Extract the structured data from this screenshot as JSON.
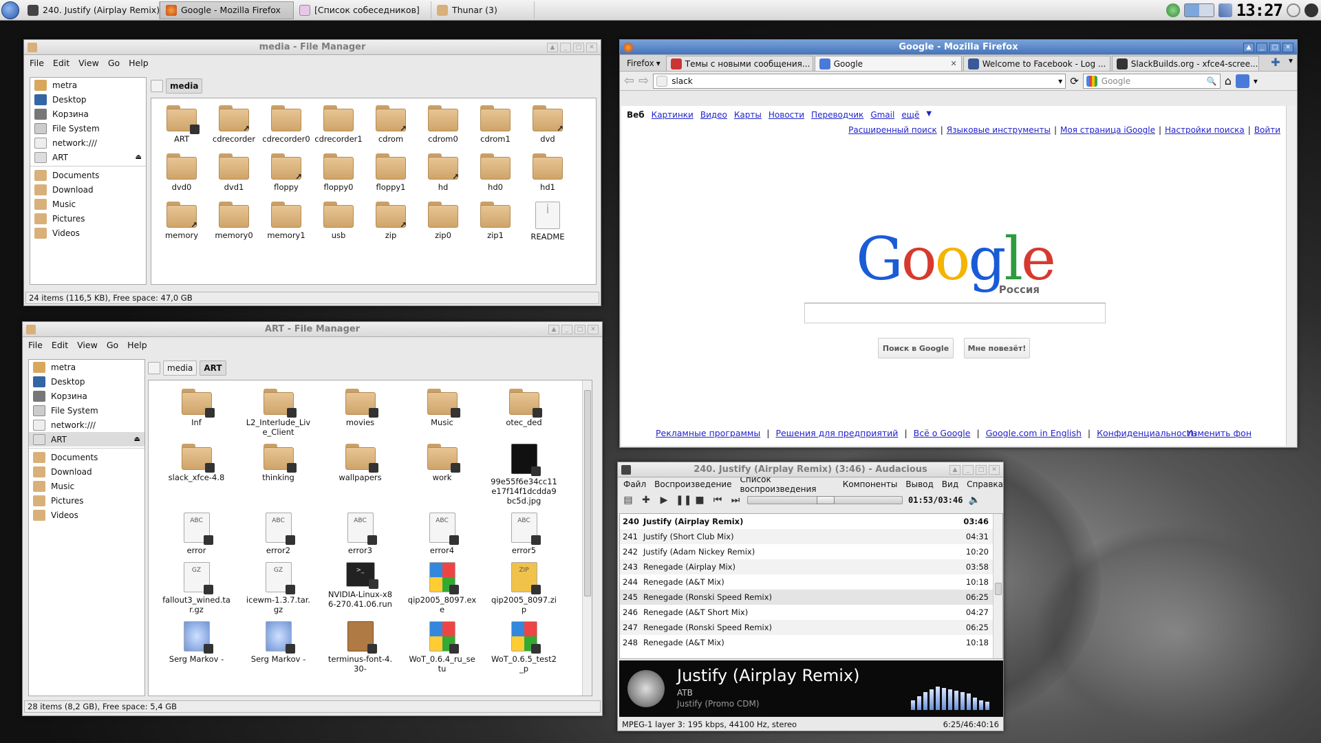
{
  "taskbar": {
    "tasks": [
      {
        "label": "240. Justify (Airplay Remix) (...",
        "icon": "audacious-icon"
      },
      {
        "label": "Google - Mozilla Firefox",
        "icon": "firefox-icon"
      },
      {
        "label": "[Список собеседников]",
        "icon": "chat-icon"
      },
      {
        "label": "Thunar (3)",
        "icon": "folder-icon"
      }
    ],
    "clock": "13:27"
  },
  "fm1": {
    "title": "media - File Manager",
    "menu": [
      "File",
      "Edit",
      "View",
      "Go",
      "Help"
    ],
    "sidebar": [
      "metra",
      "Desktop",
      "Корзина",
      "File System",
      "network:///",
      "ART",
      "Documents",
      "Download",
      "Music",
      "Pictures",
      "Videos"
    ],
    "crumbs": [
      "media"
    ],
    "items": [
      {
        "name": "ART",
        "badge": "lock"
      },
      {
        "name": "cdrecorder",
        "badge": "link"
      },
      {
        "name": "cdrecorder0",
        "badge": ""
      },
      {
        "name": "cdrecorder1",
        "badge": ""
      },
      {
        "name": "cdrom",
        "badge": "link"
      },
      {
        "name": "cdrom0",
        "badge": ""
      },
      {
        "name": "cdrom1",
        "badge": ""
      },
      {
        "name": "dvd",
        "badge": "link"
      },
      {
        "name": "dvd0",
        "badge": ""
      },
      {
        "name": "dvd1",
        "badge": ""
      },
      {
        "name": "floppy",
        "badge": "link"
      },
      {
        "name": "floppy0",
        "badge": ""
      },
      {
        "name": "floppy1",
        "badge": ""
      },
      {
        "name": "hd",
        "badge": "link"
      },
      {
        "name": "hd0",
        "badge": ""
      },
      {
        "name": "hd1",
        "badge": ""
      },
      {
        "name": "memory",
        "badge": "link"
      },
      {
        "name": "memory0",
        "badge": ""
      },
      {
        "name": "memory1",
        "badge": ""
      },
      {
        "name": "usb",
        "badge": ""
      },
      {
        "name": "zip",
        "badge": "link"
      },
      {
        "name": "zip0",
        "badge": ""
      },
      {
        "name": "zip1",
        "badge": ""
      },
      {
        "name": "README",
        "badge": "",
        "type": "info"
      }
    ],
    "status": "24 items (116,5 KB), Free space: 47,0 GB"
  },
  "fm2": {
    "title": "ART - File Manager",
    "menu": [
      "File",
      "Edit",
      "View",
      "Go",
      "Help"
    ],
    "sidebar": [
      "metra",
      "Desktop",
      "Корзина",
      "File System",
      "network:///",
      "ART",
      "Documents",
      "Download",
      "Music",
      "Pictures",
      "Videos"
    ],
    "crumbs": [
      "media",
      "ART"
    ],
    "items": [
      {
        "name": "Inf",
        "type": "folder"
      },
      {
        "name": "L2_Interlude_Live_Client",
        "type": "folder"
      },
      {
        "name": "movies",
        "type": "folder"
      },
      {
        "name": "Music",
        "type": "folder"
      },
      {
        "name": "otec_ded",
        "type": "folder"
      },
      {
        "name": "slack_xfce-4.8",
        "type": "folder"
      },
      {
        "name": "thinking",
        "type": "folder"
      },
      {
        "name": "wallpapers",
        "type": "folder"
      },
      {
        "name": "work",
        "type": "folder"
      },
      {
        "name": "99e55f6e34cc11e17f14f1dcdda9bc5d.jpg",
        "type": "image"
      },
      {
        "name": "error",
        "type": "text"
      },
      {
        "name": "error2",
        "type": "text"
      },
      {
        "name": "error3",
        "type": "text"
      },
      {
        "name": "error4",
        "type": "text"
      },
      {
        "name": "error5",
        "type": "text"
      },
      {
        "name": "fallout3_wined.tar.gz",
        "type": "gz"
      },
      {
        "name": "icewm-1.3.7.tar.gz",
        "type": "gz"
      },
      {
        "name": "NVIDIA-Linux-x86-270.41.06.run",
        "type": "run"
      },
      {
        "name": "qip2005_8097.exe",
        "type": "exe"
      },
      {
        "name": "qip2005_8097.zip",
        "type": "zip"
      },
      {
        "name": "Serg Markov -",
        "type": "html"
      },
      {
        "name": "Serg Markov -",
        "type": "html"
      },
      {
        "name": "terminus-font-4.30-",
        "type": "pkg"
      },
      {
        "name": "WoT_0.6.4_ru_setu",
        "type": "exe"
      },
      {
        "name": "WoT_0.6.5_test2_p",
        "type": "exe"
      }
    ],
    "status": "28 items (8,2 GB), Free space: 5,4 GB"
  },
  "firefox": {
    "title": "Google - Mozilla Firefox",
    "menu_label": "Firefox",
    "tabs": [
      {
        "label": "Темы с новыми сообщения...",
        "sel": false
      },
      {
        "label": "Google",
        "sel": true
      },
      {
        "label": "Welcome to Facebook - Log ...",
        "sel": false
      },
      {
        "label": "SlackBuilds.org - xfce4-scree...",
        "sel": false
      }
    ],
    "url": "slack",
    "search_placeholder": "Google",
    "topnav": [
      "Веб",
      "Картинки",
      "Видео",
      "Карты",
      "Новости",
      "Переводчик",
      "Gmail",
      "ещё"
    ],
    "toplinks": [
      "Расширенный поиск",
      "Языковые инструменты",
      "Моя страница iGoogle",
      "Настройки поиска",
      "Войти"
    ],
    "logo": "Google",
    "logo_sub": "Россия",
    "btn_search": "Поиск в Google",
    "btn_lucky": "Мне повезёт!",
    "footer": [
      "Рекламные программы",
      "Решения для предприятий",
      "Всё о Google",
      "Google.com in English",
      "Конфиденциальность"
    ],
    "change_bg": "Изменить фон"
  },
  "audacious": {
    "title": "240. Justify (Airplay Remix) (3:46) - Audacious",
    "menu": [
      "Файл",
      "Воспроизведение",
      "Список воспроизведения",
      "Компоненты",
      "Вывод",
      "Вид",
      "Справка"
    ],
    "time": "01:53/03:46",
    "progress": 0.5,
    "playlist": [
      {
        "n": "240",
        "title": "Justify (Airplay Remix)",
        "len": "03:46",
        "current": true
      },
      {
        "n": "241",
        "title": "Justify (Short Club Mix)",
        "len": "04:31"
      },
      {
        "n": "242",
        "title": "Justify (Adam Nickey Remix)",
        "len": "10:20"
      },
      {
        "n": "243",
        "title": "Renegade (Airplay Mix)",
        "len": "03:58"
      },
      {
        "n": "244",
        "title": "Renegade (A&T Mix)",
        "len": "10:18"
      },
      {
        "n": "245",
        "title": "Renegade (Ronski Speed Remix)",
        "len": "06:25",
        "selected": true
      },
      {
        "n": "246",
        "title": "Renegade (A&T Short Mix)",
        "len": "04:27"
      },
      {
        "n": "247",
        "title": "Renegade (Ronski Speed Remix)",
        "len": "06:25"
      },
      {
        "n": "248",
        "title": "Renegade (A&T Mix)",
        "len": "10:18"
      }
    ],
    "np_title": "Justify (Airplay Remix)",
    "np_artist": "ATB",
    "np_album": "Justify (Promo CDM)",
    "status_left": "MPEG-1 layer 3: 195 kbps, 44100 Hz, stereo",
    "status_right": "6:25/46:40:16"
  }
}
